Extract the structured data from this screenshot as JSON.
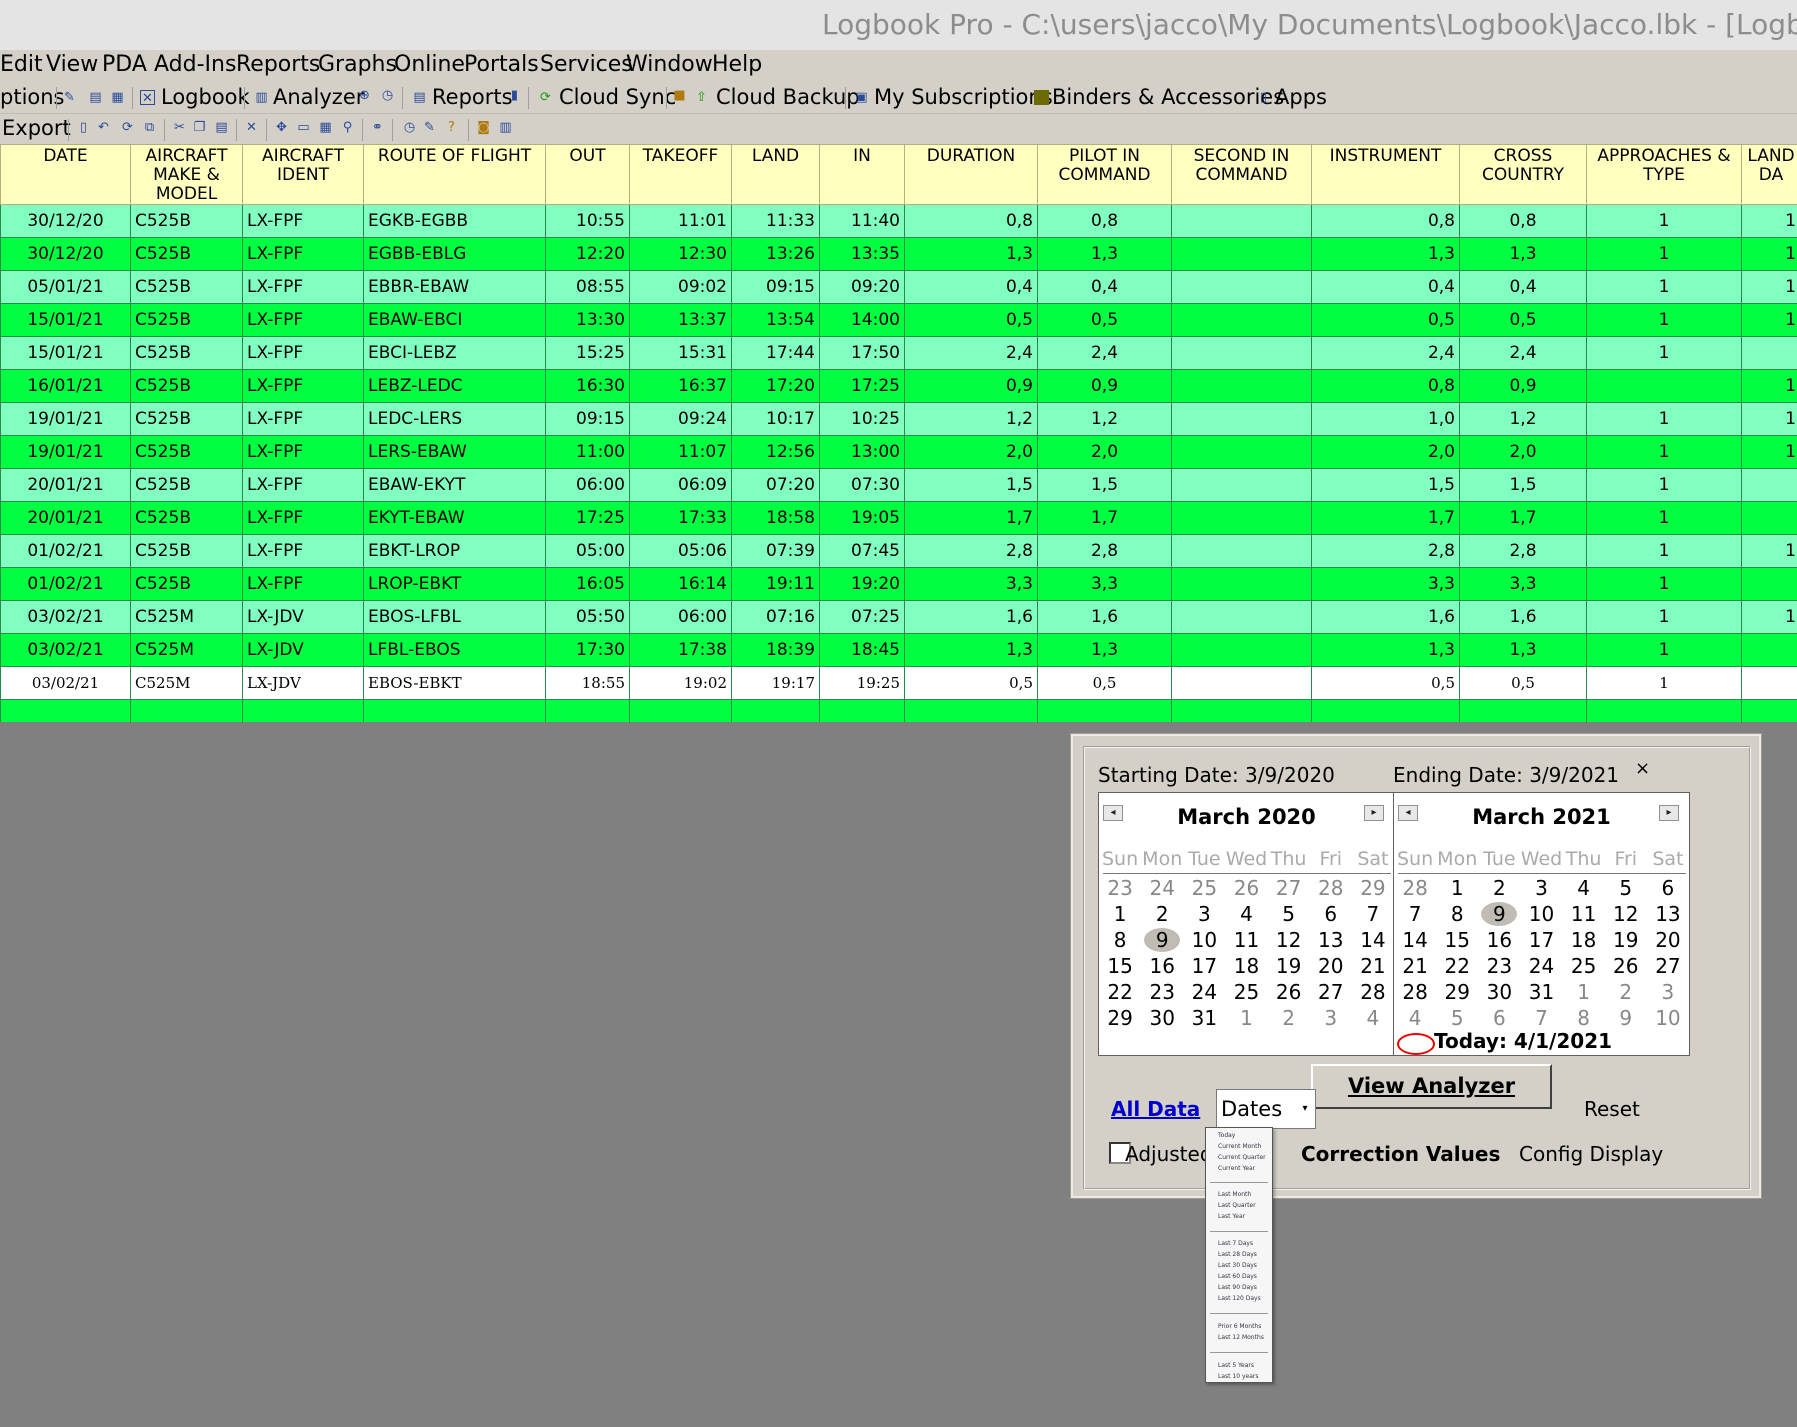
{
  "window": {
    "title": "Logbook Pro - C:\\users\\jacco\\My Documents\\Logbook\\Jacco.lbk - [Logbook (Sp"
  },
  "menu": [
    "Edit",
    "View",
    "PDA",
    "Add-Ins",
    "Reports",
    "Graphs",
    "Online",
    "Portals",
    "Services",
    "Window",
    "Help"
  ],
  "toolbar": {
    "options": "ptions",
    "logbook": "Logbook",
    "analyzer": "Analyzer",
    "reports": "Reports",
    "cloud_sync": "Cloud Sync",
    "cloud_backup": "Cloud Backup",
    "subscriptions": "My Subscriptions",
    "binders": "Binders & Accessories",
    "apps": "Apps",
    "export": "Export"
  },
  "columns": [
    "DATE",
    "AIRCRAFT MAKE & MODEL",
    "AIRCRAFT IDENT",
    "ROUTE OF FLIGHT",
    "OUT",
    "TAKEOFF",
    "LAND",
    "IN",
    "DURATION",
    "PILOT IN COMMAND",
    "SECOND IN COMMAND",
    "INSTRUMENT",
    "CROSS COUNTRY",
    "APPROACHES & TYPE",
    "LAND DA"
  ],
  "rows": [
    [
      "30/12/20",
      "C525B",
      "LX-FPF",
      "EGKB-EGBB",
      "10:55",
      "11:01",
      "11:33",
      "11:40",
      "0,8",
      "0,8",
      "",
      "0,8",
      "0,8",
      "1",
      "1"
    ],
    [
      "30/12/20",
      "C525B",
      "LX-FPF",
      "EGBB-EBLG",
      "12:20",
      "12:30",
      "13:26",
      "13:35",
      "1,3",
      "1,3",
      "",
      "1,3",
      "1,3",
      "1",
      "1"
    ],
    [
      "05/01/21",
      "C525B",
      "LX-FPF",
      "EBBR-EBAW",
      "08:55",
      "09:02",
      "09:15",
      "09:20",
      "0,4",
      "0,4",
      "",
      "0,4",
      "0,4",
      "1",
      "1"
    ],
    [
      "15/01/21",
      "C525B",
      "LX-FPF",
      "EBAW-EBCI",
      "13:30",
      "13:37",
      "13:54",
      "14:00",
      "0,5",
      "0,5",
      "",
      "0,5",
      "0,5",
      "1",
      "1"
    ],
    [
      "15/01/21",
      "C525B",
      "LX-FPF",
      "EBCI-LEBZ",
      "15:25",
      "15:31",
      "17:44",
      "17:50",
      "2,4",
      "2,4",
      "",
      "2,4",
      "2,4",
      "1",
      ""
    ],
    [
      "16/01/21",
      "C525B",
      "LX-FPF",
      "LEBZ-LEDC",
      "16:30",
      "16:37",
      "17:20",
      "17:25",
      "0,9",
      "0,9",
      "",
      "0,8",
      "0,9",
      "",
      "1"
    ],
    [
      "19/01/21",
      "C525B",
      "LX-FPF",
      "LEDC-LERS",
      "09:15",
      "09:24",
      "10:17",
      "10:25",
      "1,2",
      "1,2",
      "",
      "1,0",
      "1,2",
      "1",
      "1"
    ],
    [
      "19/01/21",
      "C525B",
      "LX-FPF",
      "LERS-EBAW",
      "11:00",
      "11:07",
      "12:56",
      "13:00",
      "2,0",
      "2,0",
      "",
      "2,0",
      "2,0",
      "1",
      "1"
    ],
    [
      "20/01/21",
      "C525B",
      "LX-FPF",
      "EBAW-EKYT",
      "06:00",
      "06:09",
      "07:20",
      "07:30",
      "1,5",
      "1,5",
      "",
      "1,5",
      "1,5",
      "1",
      ""
    ],
    [
      "20/01/21",
      "C525B",
      "LX-FPF",
      "EKYT-EBAW",
      "17:25",
      "17:33",
      "18:58",
      "19:05",
      "1,7",
      "1,7",
      "",
      "1,7",
      "1,7",
      "1",
      ""
    ],
    [
      "01/02/21",
      "C525B",
      "LX-FPF",
      "EBKT-LROP",
      "05:00",
      "05:06",
      "07:39",
      "07:45",
      "2,8",
      "2,8",
      "",
      "2,8",
      "2,8",
      "1",
      "1"
    ],
    [
      "01/02/21",
      "C525B",
      "LX-FPF",
      "LROP-EBKT",
      "16:05",
      "16:14",
      "19:11",
      "19:20",
      "3,3",
      "3,3",
      "",
      "3,3",
      "3,3",
      "1",
      ""
    ],
    [
      "03/02/21",
      "C525M",
      "LX-JDV",
      "EBOS-LFBL",
      "05:50",
      "06:00",
      "07:16",
      "07:25",
      "1,6",
      "1,6",
      "",
      "1,6",
      "1,6",
      "1",
      "1"
    ],
    [
      "03/02/21",
      "C525M",
      "LX-JDV",
      "LFBL-EBOS",
      "17:30",
      "17:38",
      "18:39",
      "18:45",
      "1,3",
      "1,3",
      "",
      "1,3",
      "1,3",
      "1",
      ""
    ],
    [
      "03/02/21",
      "C525M",
      "LX-JDV",
      "EBOS-EBKT",
      "18:55",
      "19:02",
      "19:17",
      "19:25",
      "0,5",
      "0,5",
      "",
      "0,5",
      "0,5",
      "1",
      ""
    ]
  ],
  "dialog": {
    "start_label": "Starting Date: 3/9/2020",
    "end_label": "Ending Date: 3/9/2021",
    "close": "×",
    "cal1": {
      "title": "March 2020",
      "dow": [
        "Sun",
        "Mon",
        "Tue",
        "Wed",
        "Thu",
        "Fri",
        "Sat"
      ],
      "days": [
        [
          "23",
          1
        ],
        [
          "24",
          1
        ],
        [
          "25",
          1
        ],
        [
          "26",
          1
        ],
        [
          "27",
          1
        ],
        [
          "28",
          1
        ],
        [
          "29",
          1
        ],
        [
          "1",
          0
        ],
        [
          "2",
          0
        ],
        [
          "3",
          0
        ],
        [
          "4",
          0
        ],
        [
          "5",
          0
        ],
        [
          "6",
          0
        ],
        [
          "7",
          0
        ],
        [
          "8",
          0
        ],
        [
          "9",
          2
        ],
        [
          "10",
          0
        ],
        [
          "11",
          0
        ],
        [
          "12",
          0
        ],
        [
          "13",
          0
        ],
        [
          "14",
          0
        ],
        [
          "15",
          0
        ],
        [
          "16",
          0
        ],
        [
          "17",
          0
        ],
        [
          "18",
          0
        ],
        [
          "19",
          0
        ],
        [
          "20",
          0
        ],
        [
          "21",
          0
        ],
        [
          "22",
          0
        ],
        [
          "23",
          0
        ],
        [
          "24",
          0
        ],
        [
          "25",
          0
        ],
        [
          "26",
          0
        ],
        [
          "27",
          0
        ],
        [
          "28",
          0
        ],
        [
          "29",
          0
        ],
        [
          "30",
          0
        ],
        [
          "31",
          0
        ],
        [
          "1",
          1
        ],
        [
          "2",
          1
        ],
        [
          "3",
          1
        ],
        [
          "4",
          1
        ]
      ]
    },
    "cal2": {
      "title": "March 2021",
      "dow": [
        "Sun",
        "Mon",
        "Tue",
        "Wed",
        "Thu",
        "Fri",
        "Sat"
      ],
      "days": [
        [
          "28",
          1
        ],
        [
          "1",
          0
        ],
        [
          "2",
          0
        ],
        [
          "3",
          0
        ],
        [
          "4",
          0
        ],
        [
          "5",
          0
        ],
        [
          "6",
          0
        ],
        [
          "7",
          0
        ],
        [
          "8",
          0
        ],
        [
          "9",
          2
        ],
        [
          "10",
          0
        ],
        [
          "11",
          0
        ],
        [
          "12",
          0
        ],
        [
          "13",
          0
        ],
        [
          "14",
          0
        ],
        [
          "15",
          0
        ],
        [
          "16",
          0
        ],
        [
          "17",
          0
        ],
        [
          "18",
          0
        ],
        [
          "19",
          0
        ],
        [
          "20",
          0
        ],
        [
          "21",
          0
        ],
        [
          "22",
          0
        ],
        [
          "23",
          0
        ],
        [
          "24",
          0
        ],
        [
          "25",
          0
        ],
        [
          "26",
          0
        ],
        [
          "27",
          0
        ],
        [
          "28",
          0
        ],
        [
          "29",
          0
        ],
        [
          "30",
          0
        ],
        [
          "31",
          0
        ],
        [
          "1",
          1
        ],
        [
          "2",
          1
        ],
        [
          "3",
          1
        ],
        [
          "4",
          1
        ],
        [
          "5",
          1
        ],
        [
          "6",
          1
        ],
        [
          "7",
          1
        ],
        [
          "8",
          1
        ],
        [
          "9",
          1
        ],
        [
          "10",
          1
        ]
      ],
      "today": "Today: 4/1/2021"
    },
    "view_analyzer": "View Analyzer",
    "all_data": "All Data",
    "dates_value": "Dates",
    "reset": "Reset",
    "adjusted": "Adjusted",
    "correction": "Correction Values",
    "config": "Config Display"
  },
  "dates_options": {
    "group1": [
      "Today",
      "Current Month",
      "Current Quarter",
      "Current Year"
    ],
    "group2": [
      "Last Month",
      "Last Quarter",
      "Last Year"
    ],
    "group3": [
      "Last 7 Days",
      "Last 28 Days",
      "Last 30 Days",
      "Last 60 Days",
      "Last 90 Days",
      "Last 120 Days"
    ],
    "group4": [
      "Prior 6 Months",
      "Last 12 Months"
    ],
    "group5": [
      "Last 5 Years",
      "Last 10 years"
    ]
  },
  "colors": {
    "row_light": "#80ffc0",
    "row_dark": "#00ff41",
    "header_bg": "#ffffc0",
    "link": "#0000cc",
    "workspace": "#808080"
  }
}
